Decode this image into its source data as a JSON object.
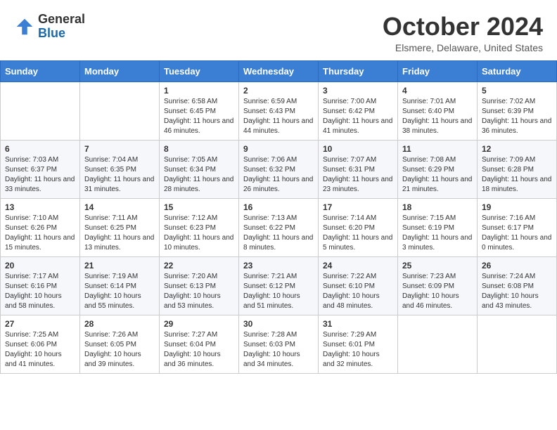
{
  "header": {
    "logo_line1": "General",
    "logo_line2": "Blue",
    "month_title": "October 2024",
    "location": "Elsmere, Delaware, United States"
  },
  "days_of_week": [
    "Sunday",
    "Monday",
    "Tuesday",
    "Wednesday",
    "Thursday",
    "Friday",
    "Saturday"
  ],
  "weeks": [
    [
      {
        "day": "",
        "detail": ""
      },
      {
        "day": "",
        "detail": ""
      },
      {
        "day": "1",
        "detail": "Sunrise: 6:58 AM\nSunset: 6:45 PM\nDaylight: 11 hours and 46 minutes."
      },
      {
        "day": "2",
        "detail": "Sunrise: 6:59 AM\nSunset: 6:43 PM\nDaylight: 11 hours and 44 minutes."
      },
      {
        "day": "3",
        "detail": "Sunrise: 7:00 AM\nSunset: 6:42 PM\nDaylight: 11 hours and 41 minutes."
      },
      {
        "day": "4",
        "detail": "Sunrise: 7:01 AM\nSunset: 6:40 PM\nDaylight: 11 hours and 38 minutes."
      },
      {
        "day": "5",
        "detail": "Sunrise: 7:02 AM\nSunset: 6:39 PM\nDaylight: 11 hours and 36 minutes."
      }
    ],
    [
      {
        "day": "6",
        "detail": "Sunrise: 7:03 AM\nSunset: 6:37 PM\nDaylight: 11 hours and 33 minutes."
      },
      {
        "day": "7",
        "detail": "Sunrise: 7:04 AM\nSunset: 6:35 PM\nDaylight: 11 hours and 31 minutes."
      },
      {
        "day": "8",
        "detail": "Sunrise: 7:05 AM\nSunset: 6:34 PM\nDaylight: 11 hours and 28 minutes."
      },
      {
        "day": "9",
        "detail": "Sunrise: 7:06 AM\nSunset: 6:32 PM\nDaylight: 11 hours and 26 minutes."
      },
      {
        "day": "10",
        "detail": "Sunrise: 7:07 AM\nSunset: 6:31 PM\nDaylight: 11 hours and 23 minutes."
      },
      {
        "day": "11",
        "detail": "Sunrise: 7:08 AM\nSunset: 6:29 PM\nDaylight: 11 hours and 21 minutes."
      },
      {
        "day": "12",
        "detail": "Sunrise: 7:09 AM\nSunset: 6:28 PM\nDaylight: 11 hours and 18 minutes."
      }
    ],
    [
      {
        "day": "13",
        "detail": "Sunrise: 7:10 AM\nSunset: 6:26 PM\nDaylight: 11 hours and 15 minutes."
      },
      {
        "day": "14",
        "detail": "Sunrise: 7:11 AM\nSunset: 6:25 PM\nDaylight: 11 hours and 13 minutes."
      },
      {
        "day": "15",
        "detail": "Sunrise: 7:12 AM\nSunset: 6:23 PM\nDaylight: 11 hours and 10 minutes."
      },
      {
        "day": "16",
        "detail": "Sunrise: 7:13 AM\nSunset: 6:22 PM\nDaylight: 11 hours and 8 minutes."
      },
      {
        "day": "17",
        "detail": "Sunrise: 7:14 AM\nSunset: 6:20 PM\nDaylight: 11 hours and 5 minutes."
      },
      {
        "day": "18",
        "detail": "Sunrise: 7:15 AM\nSunset: 6:19 PM\nDaylight: 11 hours and 3 minutes."
      },
      {
        "day": "19",
        "detail": "Sunrise: 7:16 AM\nSunset: 6:17 PM\nDaylight: 11 hours and 0 minutes."
      }
    ],
    [
      {
        "day": "20",
        "detail": "Sunrise: 7:17 AM\nSunset: 6:16 PM\nDaylight: 10 hours and 58 minutes."
      },
      {
        "day": "21",
        "detail": "Sunrise: 7:19 AM\nSunset: 6:14 PM\nDaylight: 10 hours and 55 minutes."
      },
      {
        "day": "22",
        "detail": "Sunrise: 7:20 AM\nSunset: 6:13 PM\nDaylight: 10 hours and 53 minutes."
      },
      {
        "day": "23",
        "detail": "Sunrise: 7:21 AM\nSunset: 6:12 PM\nDaylight: 10 hours and 51 minutes."
      },
      {
        "day": "24",
        "detail": "Sunrise: 7:22 AM\nSunset: 6:10 PM\nDaylight: 10 hours and 48 minutes."
      },
      {
        "day": "25",
        "detail": "Sunrise: 7:23 AM\nSunset: 6:09 PM\nDaylight: 10 hours and 46 minutes."
      },
      {
        "day": "26",
        "detail": "Sunrise: 7:24 AM\nSunset: 6:08 PM\nDaylight: 10 hours and 43 minutes."
      }
    ],
    [
      {
        "day": "27",
        "detail": "Sunrise: 7:25 AM\nSunset: 6:06 PM\nDaylight: 10 hours and 41 minutes."
      },
      {
        "day": "28",
        "detail": "Sunrise: 7:26 AM\nSunset: 6:05 PM\nDaylight: 10 hours and 39 minutes."
      },
      {
        "day": "29",
        "detail": "Sunrise: 7:27 AM\nSunset: 6:04 PM\nDaylight: 10 hours and 36 minutes."
      },
      {
        "day": "30",
        "detail": "Sunrise: 7:28 AM\nSunset: 6:03 PM\nDaylight: 10 hours and 34 minutes."
      },
      {
        "day": "31",
        "detail": "Sunrise: 7:29 AM\nSunset: 6:01 PM\nDaylight: 10 hours and 32 minutes."
      },
      {
        "day": "",
        "detail": ""
      },
      {
        "day": "",
        "detail": ""
      }
    ]
  ]
}
